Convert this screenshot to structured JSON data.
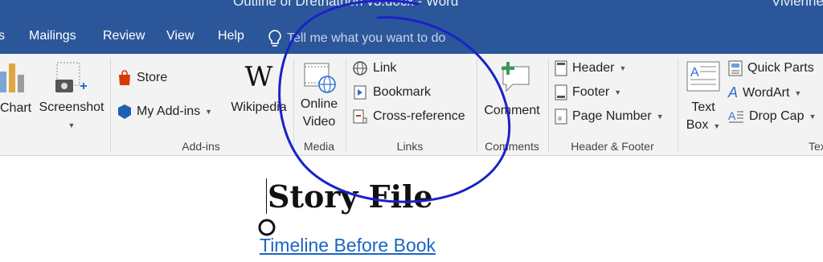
{
  "window": {
    "title": "Outline of Drethathon v3.docx - Word",
    "user": "Vivienne"
  },
  "tabs": [
    "s",
    "Mailings",
    "Review",
    "View",
    "Help"
  ],
  "tellme": {
    "placeholder": "Tell me what you want to do"
  },
  "ribbon": {
    "chart": {
      "label": "Chart"
    },
    "screenshot": {
      "label": "Screenshot"
    },
    "addins": {
      "store": "Store",
      "my_addins": "My Add-ins",
      "wikipedia": "Wikipedia",
      "group": "Add-ins"
    },
    "media": {
      "line1": "Online",
      "line2": "Video",
      "group": "Media"
    },
    "links": {
      "link": "Link",
      "bookmark": "Bookmark",
      "crossref": "Cross-reference",
      "group": "Links"
    },
    "comments": {
      "comment": "Comment",
      "group": "Comments"
    },
    "header_footer": {
      "header": "Header",
      "footer": "Footer",
      "page_number": "Page Number",
      "group": "Header & Footer"
    },
    "text": {
      "textbox1": "Text",
      "textbox2": "Box",
      "quick_parts": "Quick Parts",
      "wordart": "WordArt",
      "drop_cap": "Drop Cap",
      "group": "Tex"
    }
  },
  "document": {
    "heading": "Story File",
    "link": "Timeline Before Book"
  },
  "colors": {
    "titlebar": "#2b579a",
    "ink": "#1a22c8",
    "link": "#1a66c2"
  }
}
